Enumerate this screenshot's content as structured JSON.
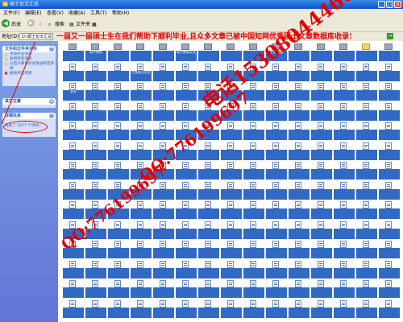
{
  "window": {
    "title": "硕士论文汇总",
    "min": "_",
    "max": "□",
    "close": "×"
  },
  "menu": [
    "文件(F)",
    "编辑(E)",
    "查看(V)",
    "收藏(A)",
    "工具(T)",
    "帮助(H)"
  ],
  "toolbar": {
    "back": "后退",
    "search": "搜索",
    "folders": "文件夹"
  },
  "address": {
    "label": "地址(D)",
    "value": "D:\\硕士论文汇总"
  },
  "ad_line": "一届又一届硕士生在我们帮助下顺利毕业,且众多文章已被中国知网优秀硕士文章数据库收录!",
  "watermarks": {
    "phone": "电话15308044466",
    "qq1": "QQ:776199697",
    "qq2": "QQ:776199697"
  },
  "sidebar": {
    "tasks_title": "文件和文件夹任务",
    "tasks": [
      "移动所选项目",
      "复制所选项目",
      "以电子邮件形式发送所选项目",
      "删除所选项目"
    ],
    "other_title": "其它位置",
    "details_title": "详细信息",
    "details_text": "选择了 3477 个项目。"
  },
  "files": [
    "",
    "电子商务",
    "",
    "",
    "",
    "电子商务论文",
    "",
    "",
    "",
    "工商管理",
    "",
    "",
    "",
    "",
    "",
    "",
    "",
    "",
    "工程硕士论文",
    "",
    "",
    "",
    "",
    "",
    "",
    "",
    "",
    "",
    "",
    "",
    "会计",
    "",
    "",
    "",
    "",
    "",
    "",
    "",
    "",
    "",
    "",
    "",
    "",
    "",
    "",
    "",
    "",
    "",
    "",
    "",
    "",
    "",
    "",
    "",
    "",
    "",
    "",
    "",
    "",
    "",
    "",
    "",
    "",
    "",
    "",
    "",
    "",
    "",
    "",
    "",
    "",
    "",
    "",
    "",
    "",
    "",
    "",
    "",
    "",
    "",
    "",
    "",
    "",
    "",
    "",
    "",
    "",
    "",
    "",
    "",
    "",
    "",
    "",
    "",
    "",
    "",
    "",
    "",
    "",
    "",
    "",
    "",
    "",
    "",
    "",
    "",
    "",
    "",
    "",
    "",
    "",
    "",
    "",
    "",
    "",
    "",
    "",
    "",
    "",
    "",
    "",
    "",
    "",
    "",
    "",
    "",
    "",
    "",
    "",
    "",
    "",
    "",
    "",
    "",
    "",
    "",
    "",
    "",
    "",
    "",
    "",
    "",
    "",
    "",
    "",
    "",
    "",
    "",
    "",
    "",
    "",
    "",
    "",
    "",
    "",
    "",
    "",
    "",
    "",
    "",
    "",
    "",
    "",
    "",
    "",
    "",
    "",
    "",
    "",
    "",
    "",
    "",
    "",
    "",
    "",
    "",
    "",
    "",
    "",
    "",
    "",
    "",
    "",
    "",
    "",
    "",
    "",
    "",
    "",
    "",
    "",
    "",
    "",
    "",
    "",
    "",
    "",
    "",
    "",
    "",
    "",
    "",
    "",
    "",
    "",
    "",
    "",
    "",
    "",
    ""
  ]
}
